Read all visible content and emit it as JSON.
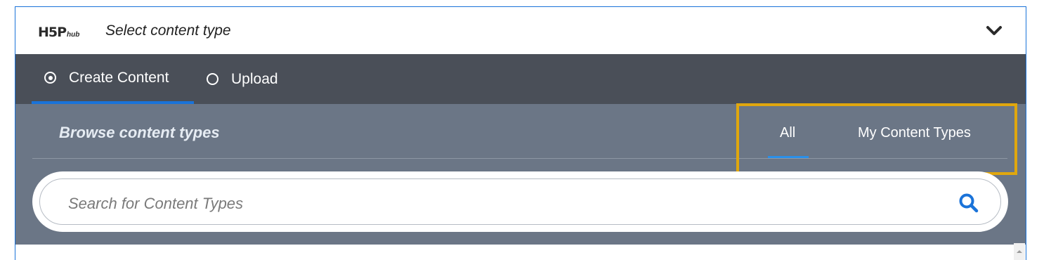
{
  "header": {
    "logo_main": "H5P",
    "logo_sub": "hub",
    "title": "Select content type"
  },
  "tabs": [
    {
      "label": "Create Content",
      "selected": true
    },
    {
      "label": "Upload",
      "selected": false
    }
  ],
  "browse": {
    "title": "Browse content types",
    "filters": [
      {
        "label": "All",
        "active": true
      },
      {
        "label": "My Content Types",
        "active": false
      }
    ]
  },
  "search": {
    "placeholder": "Search for Content Types"
  },
  "colors": {
    "accent": "#1a73d9",
    "tabs_bar": "#4a4f58",
    "browse_panel": "#6b7686",
    "highlight": "#e0a70e"
  },
  "icons": [
    "chevron-down-icon",
    "radio-checked-icon",
    "radio-unchecked-icon",
    "search-icon",
    "scroll-up-icon"
  ]
}
